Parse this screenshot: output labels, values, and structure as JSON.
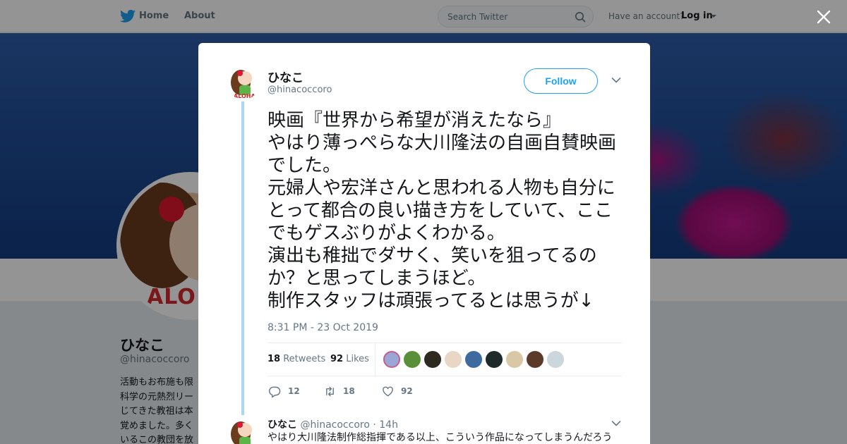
{
  "nav": {
    "home_label": "Home",
    "about_label": "About",
    "search_placeholder": "Search Twitter",
    "have_account": "Have an account?",
    "login_label": "Log in"
  },
  "profile": {
    "name": "ひなこ",
    "handle": "@hinacoccoro",
    "bio_lines": [
      "活動もお布施も限",
      "科学の元熱烈リー",
      "じてきた教祖は本",
      "覚めました。多く",
      "いるこの教団を放"
    ],
    "avatar_text": "ALO"
  },
  "tweet": {
    "author_name": "ひなこ",
    "author_handle": "@hinacoccoro",
    "follow_label": "Follow",
    "text": "映画『世界から希望が消えたなら』\nやはり薄っぺらな大川隆法の自画自賛映画でした。\n元婦人や宏洋さんと思われる人物も自分にとって都合の良い描き方をしていて、ここでもゲスぶりがよくわかる。\n演出も稚拙でダサく、笑いを狙ってるのか？と思ってしまうほど。\n制作スタッフは頑張ってるとは思うが↓",
    "timestamp": "8:31 PM - 23 Oct 2019",
    "retweets_count": "18",
    "retweets_label": "Retweets",
    "likes_count": "92",
    "likes_label": "Likes",
    "reply_count": "12",
    "retweet_count_action": "18",
    "like_count_action": "92"
  },
  "reply": {
    "author_name": "ひなこ",
    "author_handle": "@hinacoccoro",
    "age": "14h",
    "separator": "·",
    "text": "やはり大川隆法制作総指揮である以上、こういう作品になってしまうんだろう"
  },
  "colors": {
    "twitter_blue": "#1da1f2",
    "thread_line": "#a8d8f5",
    "muted_text": "#657786"
  },
  "icons": {
    "logo": "twitter-bird-icon",
    "search": "search-icon",
    "close": "close-icon",
    "menu": "chevron-down-icon",
    "reply": "reply-icon",
    "retweet": "retweet-icon",
    "like": "heart-icon"
  }
}
